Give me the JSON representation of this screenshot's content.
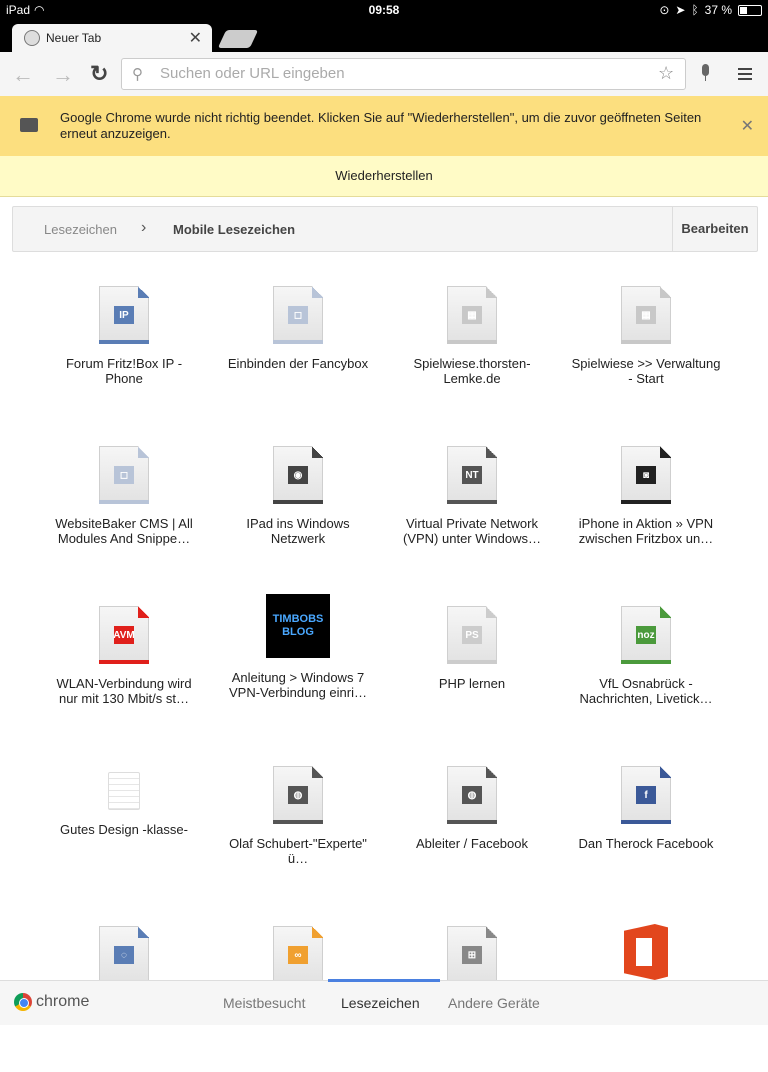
{
  "status_bar": {
    "device": "iPad",
    "time": "09:58",
    "battery": "37 %",
    "battery_level": 0.37
  },
  "tab": {
    "title": "Neuer Tab"
  },
  "toolbar": {
    "search_placeholder": "Suchen oder URL eingeben"
  },
  "infobar": {
    "message": "Google Chrome wurde nicht richtig beendet. Klicken Sie auf \"Wiederherstellen\", um die zuvor geöffneten Seiten erneut anzuzeigen.",
    "restore_label": "Wiederherstellen"
  },
  "breadcrumb": {
    "root": "Lesezeichen",
    "current": "Mobile Lesezeichen",
    "edit_label": "Bearbeiten"
  },
  "bookmarks": [
    {
      "label": "Forum Fritz!Box IP - Phone",
      "icon": "ip-phone-favicon",
      "accent": "#5a7db5",
      "glyph": "IP"
    },
    {
      "label": "Einbinden der Fancybox",
      "icon": "fancybox-favicon",
      "accent": "#b8c4d8",
      "glyph": "◻"
    },
    {
      "label": "Spielwiese.thorsten-Lemke.de",
      "icon": "site-favicon",
      "accent": "#c8c8c8",
      "glyph": "▦"
    },
    {
      "label": "Spielwiese >> Verwaltung - Start",
      "icon": "site-favicon",
      "accent": "#c8c8c8",
      "glyph": "▦"
    },
    {
      "label": "WebsiteBaker CMS | All Modules And Snippe…",
      "icon": "websitebaker-favicon",
      "accent": "#b8c4d8",
      "glyph": "◻"
    },
    {
      "label": "IPad ins Windows Netzwerk",
      "icon": "target-favicon",
      "accent": "#444444",
      "glyph": "◉"
    },
    {
      "label": "Virtual Private Network (VPN) unter Windows…",
      "icon": "nt-favicon",
      "accent": "#555555",
      "glyph": "NT"
    },
    {
      "label": "iPhone in Aktion » VPN zwischen Fritzbox un…",
      "icon": "chat-favicon",
      "accent": "#222222",
      "glyph": "◙"
    },
    {
      "label": "WLAN-Verbindung wird nur mit 130 Mbit/s st…",
      "icon": "avm-favicon",
      "accent": "#e0201b",
      "glyph": "AVM"
    },
    {
      "label": "Anleitung > Windows 7 VPN-Verbindung einri…",
      "icon": "timbobs-blog-thumbnail",
      "accent": "#000000",
      "glyph": "TIMBOBS BLOG"
    },
    {
      "label": "PHP lernen",
      "icon": "ps-favicon",
      "accent": "#cccccc",
      "glyph": "PS"
    },
    {
      "label": "VfL Osnabrück - Nachrichten, Livetick…",
      "icon": "noz-favicon",
      "accent": "#4b9a3c",
      "glyph": "noz"
    },
    {
      "label": "Gutes Design -klasse-",
      "icon": "notepad-icon",
      "accent": "#dddddd",
      "glyph": ""
    },
    {
      "label": "Olaf Schubert-\"Experte\" ü…",
      "icon": "globe-favicon",
      "accent": "#555555",
      "glyph": "◍"
    },
    {
      "label": "Ableiter / Facebook",
      "icon": "globe-favicon",
      "accent": "#555555",
      "glyph": "◍"
    },
    {
      "label": "Dan Therock Facebook",
      "icon": "facebook-favicon",
      "accent": "#3b5998",
      "glyph": "f"
    },
    {
      "label": "",
      "icon": "circle-favicon",
      "accent": "#5a7db5",
      "glyph": "◌"
    },
    {
      "label": "",
      "icon": "orange-favicon",
      "accent": "#f0a030",
      "glyph": "∞"
    },
    {
      "label": "",
      "icon": "windows-favicon",
      "accent": "#888888",
      "glyph": "⊞"
    },
    {
      "label": "",
      "icon": "office-icon",
      "accent": "#e2461d",
      "glyph": ""
    }
  ],
  "bottom_bar": {
    "brand": "chrome",
    "tabs": [
      {
        "label": "Meistbesucht",
        "active": false
      },
      {
        "label": "Lesezeichen",
        "active": true
      },
      {
        "label": "Andere Geräte",
        "active": false
      }
    ]
  }
}
